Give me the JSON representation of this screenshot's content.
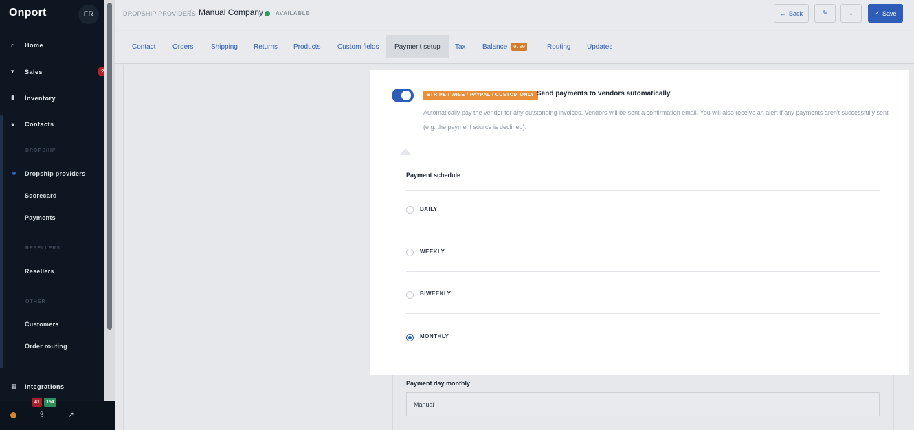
{
  "sidebar": {
    "brand": "Onport",
    "lang": "FR",
    "nav": [
      {
        "label": "Home",
        "icon": "home-icon"
      },
      {
        "label": "Sales",
        "icon": "cart-icon",
        "badge": "2"
      },
      {
        "label": "Inventory",
        "icon": "bookmark-icon"
      },
      {
        "label": "Contacts",
        "icon": "user-icon"
      }
    ],
    "sections": {
      "dropship": "DROPSHIP",
      "resellers": "RESELLERS",
      "other": "OTHER"
    },
    "sub_items": {
      "dropship_providers": "Dropship providers",
      "scorecard": "Scorecard",
      "payments": "Payments",
      "resellers": "Resellers",
      "customers": "Customers",
      "order_routing": "Order routing"
    },
    "integrations": "Integrations",
    "footer_counts": {
      "red": "41",
      "green": "154"
    }
  },
  "header": {
    "breadcrumb": "DROPSHIP PROVIDERS",
    "separator": "/",
    "title": "Manual Company",
    "status": "AVAILABLE",
    "status_color": "#2d9b63",
    "back_label": "Back",
    "save_label": "Save"
  },
  "tabs": {
    "contact": "Contact",
    "orders": "Orders",
    "shipping": "Shipping",
    "returns": "Returns",
    "products": "Products",
    "custom_fields": "Custom fields",
    "payment_setup": "Payment setup",
    "tax": "Tax",
    "balance": "Balance",
    "balance_value": "0.00",
    "routing": "Routing",
    "updates": "Updates"
  },
  "payment": {
    "tag": "STRIPE / WISE / PAYPAL / CUSTOM ONLY",
    "auto_title": "Send payments to vendors automatically",
    "auto_desc": "Automatically pay the vendor for any outstanding invoices. Vendors will be sent a confirmation email. You will also receive an alert if any payments aren't successfully sent (e.g. the payment source is declined).",
    "toggle_on": true,
    "schedule_title": "Payment schedule",
    "options": {
      "daily": "DAILY",
      "weekly": "WEEKLY",
      "biweekly": "BIWEEKLY",
      "monthly": "MONTHLY"
    },
    "selected": "MONTHLY",
    "day_label": "Payment day monthly",
    "day_value": "Manual"
  },
  "colors": {
    "accent": "#2d5db8",
    "tag_orange": "#e98e3a",
    "sidebar_bg": "#0d1621"
  }
}
